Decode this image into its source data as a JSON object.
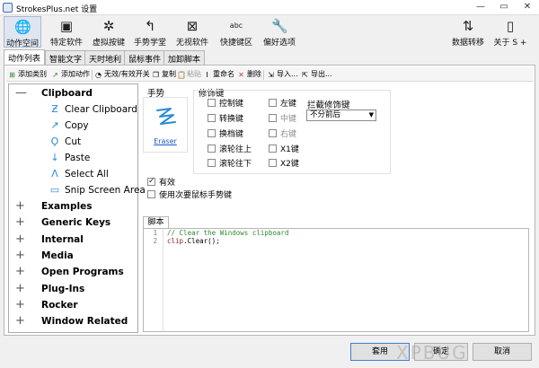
{
  "window": {
    "title": "StrokesPlus.net 设置",
    "controls": [
      "—",
      "▭",
      "✕"
    ]
  },
  "toolbar": {
    "items": [
      {
        "label": "动作空间",
        "icon": "globe-icon"
      },
      {
        "label": "特定软件",
        "icon": "app-window-icon"
      },
      {
        "label": "虚拟按键",
        "icon": "gear-icon"
      },
      {
        "label": "手势学堂",
        "icon": "gesture-arrow-icon"
      },
      {
        "label": "无视软件",
        "icon": "block-window-icon"
      },
      {
        "label": "快捷键区",
        "icon": "keyboard-icon"
      },
      {
        "label": "偏好选项",
        "icon": "wrench-icon"
      },
      {
        "label": "数据转移",
        "icon": "data-transfer-icon"
      },
      {
        "label": "关于 S +",
        "icon": "info-icon"
      }
    ]
  },
  "tabs": [
    "动作列表",
    "智能文字",
    "天时地利",
    "鼠标事件",
    "加卸脚本"
  ],
  "actionbar": {
    "add_category": "添加类别",
    "add_action": "添加动作",
    "toggle": "无效/有效开关",
    "copy": "复制",
    "paste": "粘贴",
    "rename": "重命名",
    "delete": "删除",
    "import": "导入...",
    "export": "导出..."
  },
  "tree": {
    "groups": [
      {
        "label": "Clipboard",
        "expanded": true,
        "items": [
          "Clear Clipboard",
          "Copy",
          "Cut",
          "Paste",
          "Select All",
          "Snip Screen Area"
        ]
      },
      {
        "label": "Examples"
      },
      {
        "label": "Generic Keys"
      },
      {
        "label": "Internal"
      },
      {
        "label": "Media"
      },
      {
        "label": "Open Programs"
      },
      {
        "label": "Plug-Ins"
      },
      {
        "label": "Rocker"
      },
      {
        "label": "Window Related"
      }
    ]
  },
  "details": {
    "gesture_title": "手势",
    "gesture_name": "Eraser",
    "modifiers_title": "修饰键",
    "modifiers_col1": [
      {
        "label": "控制键",
        "checked": false
      },
      {
        "label": "转换键",
        "checked": false
      },
      {
        "label": "换档键",
        "checked": false
      },
      {
        "label": "滚轮往上",
        "checked": false
      },
      {
        "label": "滚轮往下",
        "checked": false
      }
    ],
    "modifiers_col2": [
      {
        "label": "左键",
        "checked": false
      },
      {
        "label": "中键",
        "checked": false
      },
      {
        "label": "右键",
        "checked": false
      },
      {
        "label": "X1键",
        "checked": false
      },
      {
        "label": "X2键",
        "checked": false
      }
    ],
    "intercept_title": "拦截修饰键",
    "intercept_value": "不分前后",
    "enabled_label": "有效",
    "enabled_checked": true,
    "secondary_label": "使用次要鼠标手势键",
    "secondary_checked": false
  },
  "script": {
    "tab": "脚本",
    "lines": [
      "1",
      "2"
    ],
    "line1": "// Clear the Windows clipboard",
    "line2_ident": "clip",
    "line2_rest": ".Clear();"
  },
  "footer": {
    "apply": "套用",
    "ok": "确定",
    "cancel": "取消",
    "watermark": "XPBUG"
  }
}
